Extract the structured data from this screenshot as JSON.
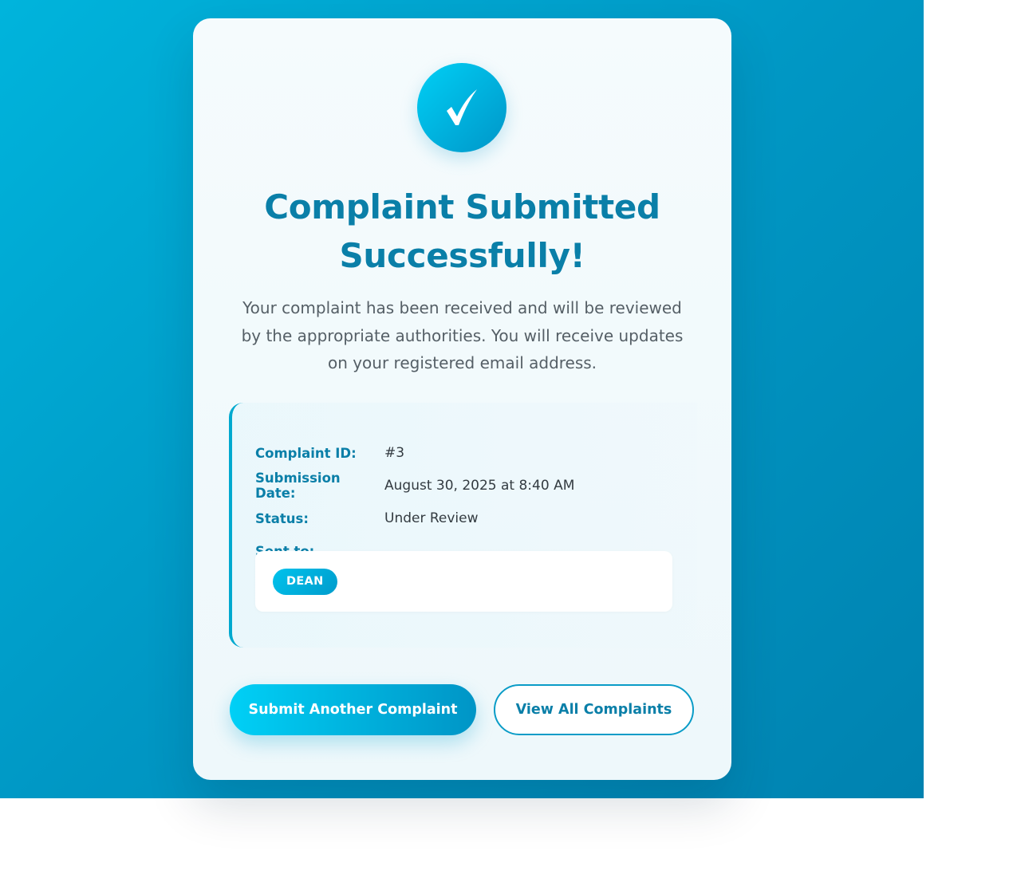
{
  "colors": {
    "accent": "#0a7fa8",
    "brand_gradient_start": "#00cff5",
    "brand_gradient_end": "#0096c8",
    "background_start": "#00b4dc",
    "background_end": "#0082b0"
  },
  "success": {
    "icon": "checkmark-icon",
    "title": "Complaint Submitted Successfully!",
    "description": "Your complaint has been received and will be reviewed by the appropriate authorities. You will receive updates on your registered email address."
  },
  "details": {
    "complaint_id_label": "Complaint ID:",
    "complaint_id_value": "#3",
    "submission_date_label": "Submission Date:",
    "submission_date_value": "August 30, 2025 at 8:40 AM",
    "status_label": "Status:",
    "status_value": "Under Review",
    "sent_to_label": "Sent to:",
    "recipients": [
      "DEAN"
    ]
  },
  "actions": {
    "submit_another_label": "Submit Another Complaint",
    "view_all_label": "View All Complaints"
  }
}
